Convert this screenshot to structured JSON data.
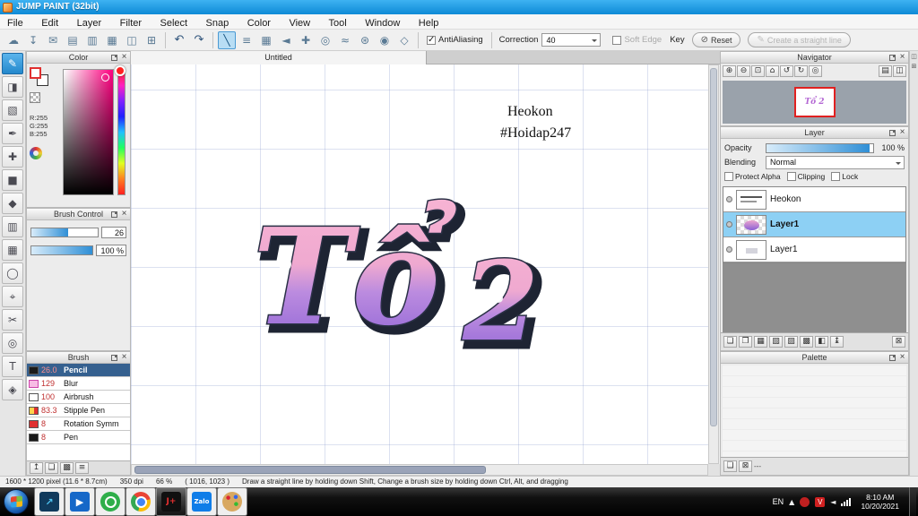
{
  "titlebar": {
    "title": "JUMP PAINT (32bit)"
  },
  "menu": {
    "items": [
      "File",
      "Edit",
      "Layer",
      "Filter",
      "Select",
      "Snap",
      "Color",
      "View",
      "Tool",
      "Window",
      "Help"
    ]
  },
  "toolbar": {
    "antialiasing_label": "AntiAliasing",
    "correction_label": "Correction",
    "correction_value": "40",
    "soft_edge_label": "Soft Edge",
    "key_label": "Key",
    "reset_label": "Reset",
    "create_line_label": "Create a straight line"
  },
  "color_panel": {
    "title": "Color",
    "r": "R:255",
    "g": "G:255",
    "b": "B:255"
  },
  "brush_control_panel": {
    "title": "Brush Control",
    "size_value": "26",
    "opacity_value": "100 %"
  },
  "brush_panel": {
    "title": "Brush",
    "items": [
      {
        "size": "26.0",
        "name": "Pencil"
      },
      {
        "size": "129",
        "name": "Blur"
      },
      {
        "size": "100",
        "name": "Airbrush"
      },
      {
        "size": "83.3",
        "name": "Stipple Pen"
      },
      {
        "size": "8",
        "name": "Rotation Symm"
      },
      {
        "size": "8",
        "name": "Pen"
      }
    ]
  },
  "navigator_panel": {
    "title": "Navigator"
  },
  "layer_panel": {
    "title": "Layer",
    "opacity_label": "Opacity",
    "opacity_value": "100 %",
    "blending_label": "Blending",
    "blending_value": "Normal",
    "protect_alpha_label": "Protect Alpha",
    "clipping_label": "Clipping",
    "lock_label": "Lock",
    "layers": [
      {
        "name": "Heokon"
      },
      {
        "name": "Layer1"
      },
      {
        "name": "Layer1"
      }
    ]
  },
  "palette_panel": {
    "title": "Palette",
    "footer_text": "---"
  },
  "canvas": {
    "tab": "Untitled",
    "note_line1": "Heokon",
    "note_line2": "#Hoidap247",
    "artwork_word1": "Tổ",
    "artwork_word2": "2",
    "artwork_full": "Tổ 2"
  },
  "status": {
    "dimensions": "1600 * 1200 pixel  (11.6 * 8.7cm)",
    "dpi": "350 dpi",
    "zoom": "66 %",
    "coords": "( 1016, 1023 )",
    "hint": "Draw a straight line by holding down Shift, Change a brush size by holding down Ctrl, Alt, and dragging"
  },
  "taskbar": {
    "lang": "EN",
    "time": "8:10 AM",
    "date": "10/20/2021",
    "zalo_label": "Zalo",
    "jump_label": "J+"
  },
  "colors": {
    "titlebar_blue": "#1a9ae0",
    "accent_blue": "#2f9fe0",
    "selection_blue": "#8dd0f4",
    "brush_selected_row": "#35608f",
    "nav_thumb_border": "#e02020",
    "artwork_pink": "#f7b3d3",
    "artwork_purple": "#8a60d5"
  },
  "icons": {
    "close": "×",
    "cloud": "☁",
    "save": "↧",
    "mail": "✉",
    "note": "▤",
    "palette_sq": "▥",
    "grid": "▦",
    "columns": "◫",
    "add_box": "⊞",
    "undo": "↶",
    "redo": "↷",
    "line": "╲",
    "parallel": "≡",
    "mesh": "▦",
    "arrow_left": "◄",
    "cross": "✚",
    "ellipse": "◎",
    "curve": "≈",
    "gear": "⊛",
    "target": "◉",
    "polygon": "◇",
    "no": "⊘",
    "pen": "✎",
    "brush": "✎",
    "eraser": "◨",
    "marquee": "▧",
    "pen_nib": "✒",
    "move": "✚",
    "rect": "■",
    "bucket": "◆",
    "gradient": "▥",
    "select_grid": "▦",
    "lasso": "◯",
    "picker": "⌖",
    "scissors": "✂",
    "shape_circle": "◎",
    "text": "T",
    "hand": "◈",
    "zoom_in": "⊕",
    "zoom_out": "⊖",
    "zoom_fit": "⊡",
    "home": "⌂",
    "rotate_ccw": "↺",
    "rotate_cw": "↻",
    "panel_list": "▤",
    "panel_dock": "◫",
    "up": "↥",
    "menu_lines": "≡",
    "layer_new": "❏",
    "layer_dup": "❐",
    "layer_grid": "▦",
    "layer_pat1": "▧",
    "layer_pat2": "▨",
    "layer_folder": "▩",
    "layer_merge": "◧",
    "layer_updown": "↨",
    "trash": "⊠",
    "caret_up": "▲",
    "v_badge": "V",
    "speaker": "◄",
    "arrow_ne": "↗",
    "play": "▶"
  }
}
